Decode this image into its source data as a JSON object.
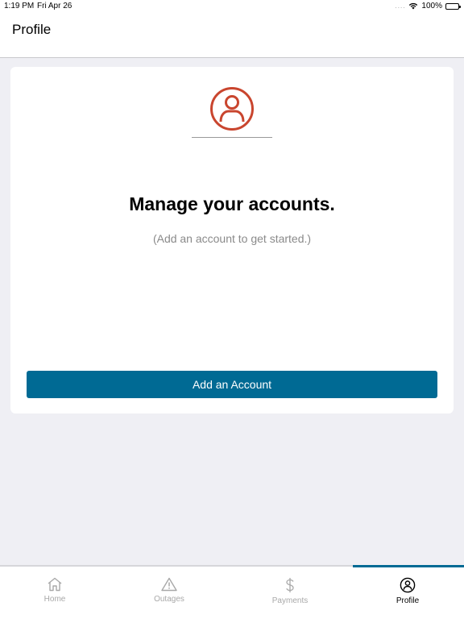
{
  "status_bar": {
    "time": "1:19 PM",
    "date": "Fri Apr 26",
    "signal": "....",
    "battery": "100%"
  },
  "header": {
    "title": "Profile"
  },
  "card": {
    "headline": "Manage your accounts.",
    "subtext": "(Add an account to get started.)",
    "button_label": "Add an Account"
  },
  "tabs": [
    {
      "label": "Home",
      "icon": "home-icon"
    },
    {
      "label": "Outages",
      "icon": "warning-icon"
    },
    {
      "label": "Payments",
      "icon": "dollar-icon"
    },
    {
      "label": "Profile",
      "icon": "profile-icon"
    }
  ],
  "active_tab": "Profile",
  "colors": {
    "accent": "#006a94",
    "avatar": "#c9452e",
    "background": "#efeff4"
  }
}
